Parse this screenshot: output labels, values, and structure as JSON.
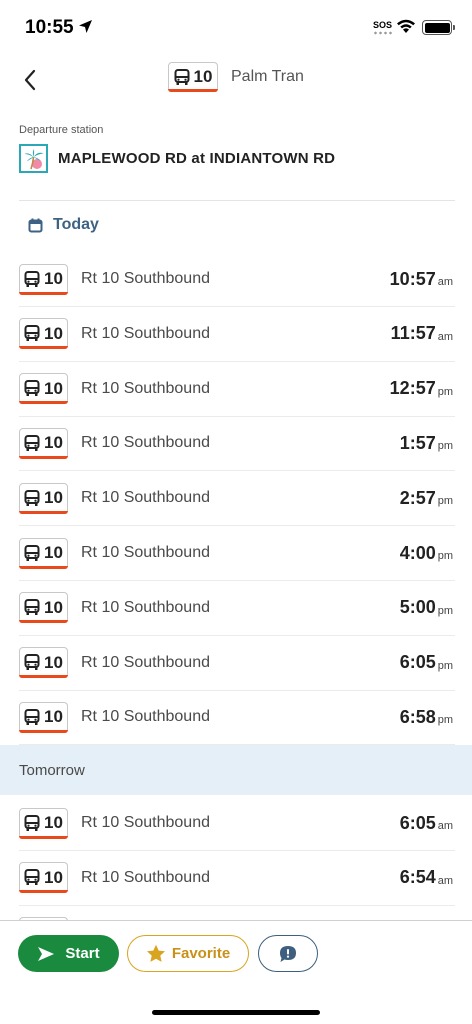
{
  "status_bar": {
    "time": "10:55",
    "sos": "SOS"
  },
  "header": {
    "route_number": "10",
    "agency": "Palm Tran"
  },
  "station": {
    "label": "Departure station",
    "name": "MAPLEWOOD RD at INDIANTOWN RD"
  },
  "today": {
    "label": "Today",
    "departures": [
      {
        "route": "10",
        "name": "Rt 10 Southbound",
        "time": "10:57",
        "ampm": "am"
      },
      {
        "route": "10",
        "name": "Rt 10 Southbound",
        "time": "11:57",
        "ampm": "am"
      },
      {
        "route": "10",
        "name": "Rt 10 Southbound",
        "time": "12:57",
        "ampm": "pm"
      },
      {
        "route": "10",
        "name": "Rt 10 Southbound",
        "time": "1:57",
        "ampm": "pm"
      },
      {
        "route": "10",
        "name": "Rt 10 Southbound",
        "time": "2:57",
        "ampm": "pm"
      },
      {
        "route": "10",
        "name": "Rt 10 Southbound",
        "time": "4:00",
        "ampm": "pm"
      },
      {
        "route": "10",
        "name": "Rt 10 Southbound",
        "time": "5:00",
        "ampm": "pm"
      },
      {
        "route": "10",
        "name": "Rt 10 Southbound",
        "time": "6:05",
        "ampm": "pm"
      },
      {
        "route": "10",
        "name": "Rt 10 Southbound",
        "time": "6:58",
        "ampm": "pm"
      }
    ]
  },
  "tomorrow": {
    "label": "Tomorrow",
    "departures": [
      {
        "route": "10",
        "name": "Rt 10 Southbound",
        "time": "6:05",
        "ampm": "am"
      },
      {
        "route": "10",
        "name": "Rt 10 Southbound",
        "time": "6:54",
        "ampm": "am"
      }
    ]
  },
  "toolbar": {
    "start_label": "Start",
    "favorite_label": "Favorite"
  },
  "colors": {
    "route_underline": "#e8491d",
    "start_green": "#1a8a3e",
    "favorite_gold": "#d9a520",
    "today_blue": "#3e6283",
    "tomorrow_band": "#e5eff7"
  },
  "icons": {
    "back": "chevron-left-icon",
    "bus": "bus-icon",
    "calendar": "calendar-icon",
    "start": "play-arrow-icon",
    "favorite": "star-icon",
    "report": "speech-bubble-exclamation-icon",
    "agency_logo": "palm-tree-icon"
  }
}
